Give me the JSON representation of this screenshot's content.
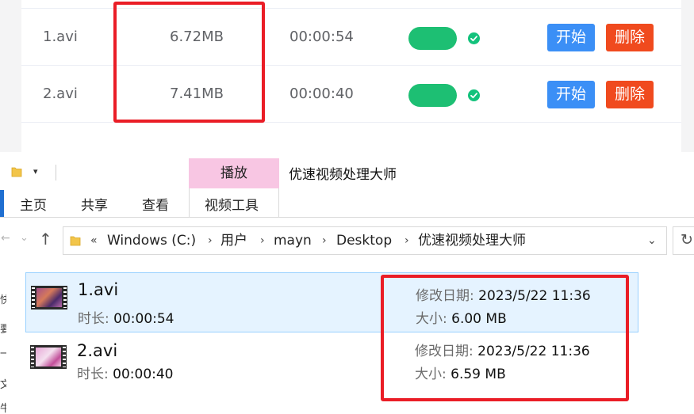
{
  "app": {
    "rows": [
      {
        "name": "1.avi",
        "size": "6.72MB",
        "duration": "00:00:54",
        "start_label": "开始",
        "delete_label": "删除"
      },
      {
        "name": "2.avi",
        "size": "7.41MB",
        "duration": "00:00:40",
        "start_label": "开始",
        "delete_label": "删除"
      }
    ]
  },
  "explorer": {
    "window_title": "优速视频处理大师",
    "context_tab": "播放",
    "ribbon_tabs": [
      "主页",
      "共享",
      "查看",
      "视频工具"
    ],
    "breadcrumb": [
      "Windows (C:)",
      "用户",
      "mayn",
      "Desktop",
      "优速视频处理大师"
    ],
    "breadcrumb_prefix": "«",
    "files": [
      {
        "name": "1.avi",
        "duration_label": "时长:",
        "duration": "00:00:54",
        "date_label": "修改日期:",
        "date": "2023/5/22 11:36",
        "size_label": "大小:",
        "size": "6.00 MB"
      },
      {
        "name": "2.avi",
        "duration_label": "时长:",
        "duration": "00:00:40",
        "date_label": "修改日期:",
        "date": "2023/5/22 11:36",
        "size_label": "大小:",
        "size": "6.59 MB"
      }
    ],
    "side_glyphs": [
      "快",
      "要",
      "一",
      "文",
      "牛"
    ]
  },
  "colors": {
    "switch_on": "#1dbf73",
    "start_button": "#3b8ff6",
    "delete_button": "#f04a1e",
    "highlight_box": "#ea1d26",
    "context_tab": "#f8c6e3",
    "selected_row": "#e5f3ff"
  },
  "icons": [
    "check-circle-icon",
    "folder-icon",
    "dropdown-arrow-icon",
    "back-arrow-icon",
    "forward-arrow-icon",
    "up-arrow-icon",
    "chevron-down-icon",
    "refresh-icon",
    "video-file-icon"
  ]
}
